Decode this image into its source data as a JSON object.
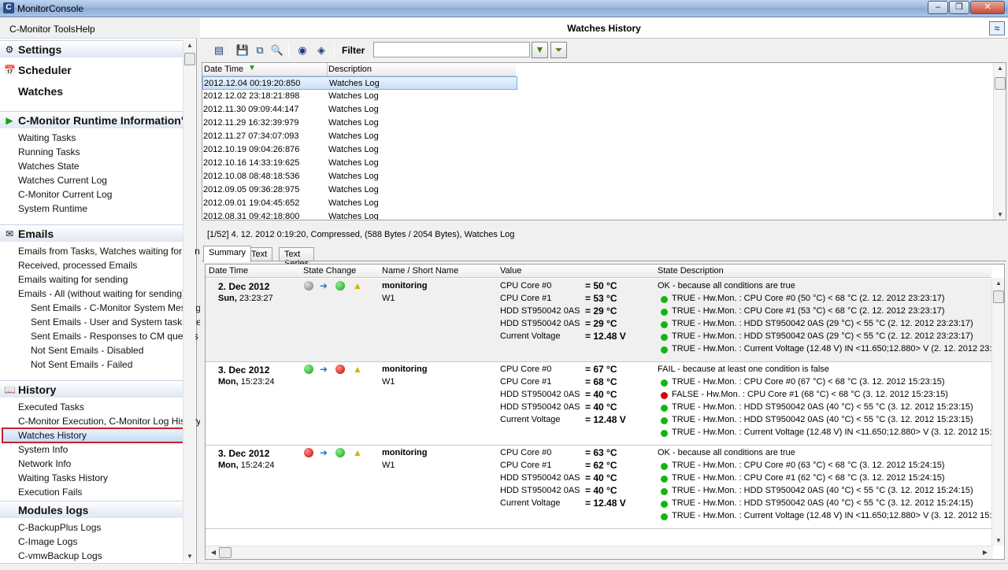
{
  "window": {
    "title": "MonitorConsole",
    "icon": "C"
  },
  "menu": {
    "tools": "C-Monitor Tools",
    "help": "Help"
  },
  "sidebar": {
    "settings": "Settings",
    "scheduler": "Scheduler",
    "watches": "Watches",
    "runtime_header": "C-Monitor Runtime Information'",
    "runtime_items": [
      "Waiting Tasks",
      "Running Tasks",
      "Watches State",
      "Watches Current Log",
      "C-Monitor Current Log",
      "System Runtime"
    ],
    "emails_header": "Emails",
    "emails_items": [
      "Emails from Tasks, Watches waiting for send",
      "Received, processed Emails",
      "Emails waiting for sending",
      "Emails - All (without waiting for sending)"
    ],
    "emails_sub": [
      "Sent Emails - C-Monitor System Message",
      "Sent Emails - User and System tasks Res",
      "Sent Emails - Responses to CM queries",
      "Not Sent Emails - Disabled",
      "Not Sent Emails - Failed"
    ],
    "history_header": "History",
    "history_items": [
      "Executed Tasks",
      "C-Monitor Execution, C-Monitor Log History",
      "Watches History",
      "System Info",
      "Network Info",
      "Waiting Tasks History",
      "Execution Fails"
    ],
    "modules_header": "Modules logs",
    "modules_items": [
      "C-BackupPlus Logs",
      "C-Image Logs",
      "C-vmwBackup Logs"
    ]
  },
  "panel": {
    "title": "Watches History",
    "filter_label": "Filter",
    "filter_value": ""
  },
  "log_grid": {
    "columns": [
      "Date Time",
      "Description"
    ],
    "rows": [
      [
        "2012.12.04  00:19:20:850",
        "Watches Log"
      ],
      [
        "2012.12.02  23:18:21:898",
        "Watches Log"
      ],
      [
        "2012.11.30  09:09:44:147",
        "Watches Log"
      ],
      [
        "2012.11.29  16:32:39:979",
        "Watches Log"
      ],
      [
        "2012.11.27  07:34:07:093",
        "Watches Log"
      ],
      [
        "2012.10.19  09:04:26:876",
        "Watches Log"
      ],
      [
        "2012.10.16  14:33:19:625",
        "Watches Log"
      ],
      [
        "2012.10.08  08:48:18:536",
        "Watches Log"
      ],
      [
        "2012.09.05  09:36:28:975",
        "Watches Log"
      ],
      [
        "2012.09.01  19:04:45:652",
        "Watches Log"
      ],
      [
        "2012.08.31  09:42:18:800",
        "Watches Log"
      ]
    ]
  },
  "info_line": "[1/52]   4. 12. 2012 0:19:20, Compressed, (588 Bytes / 2054 Bytes), Watches Log",
  "tabs": [
    "Summary",
    "Text",
    "Text Series"
  ],
  "summary": {
    "columns": [
      "Date Time",
      "State Change",
      "Name / Short Name",
      "Value",
      "State Description"
    ],
    "records": [
      {
        "date": "2. Dec 2012",
        "weekday": "Sun,",
        "time": "23:23:27",
        "state_from": "gray",
        "state_to": "green",
        "name": "monitoring",
        "short": "W1",
        "values": [
          [
            "CPU Core #0",
            "= 50 °C"
          ],
          [
            "CPU Core #1",
            "= 53 °C"
          ],
          [
            "HDD ST950042 0AS",
            "= 29 °C"
          ],
          [
            "HDD ST950042 0AS",
            "= 29 °C"
          ],
          [
            "Current Voltage",
            "= 12.48 V"
          ]
        ],
        "state_summary": "OK - because all conditions are true",
        "conditions": [
          [
            "green",
            "TRUE - Hw.Mon. : CPU Core #0 (50 °C) < 68 °C (2. 12. 2012 23:23:17)"
          ],
          [
            "green",
            "TRUE - Hw.Mon. : CPU Core #1 (53 °C) < 68 °C (2. 12. 2012 23:23:17)"
          ],
          [
            "green",
            "TRUE - Hw.Mon. : HDD ST950042 0AS (29 °C) < 55 °C (2. 12. 2012 23:23:17)"
          ],
          [
            "green",
            "TRUE - Hw.Mon. : HDD ST950042 0AS (29 °C) < 55 °C (2. 12. 2012 23:23:17)"
          ],
          [
            "green",
            "TRUE - Hw.Mon. : Current Voltage (12.48 V) IN <11.650;12.880> V (2. 12. 2012 23:2"
          ]
        ]
      },
      {
        "date": "3. Dec 2012",
        "weekday": "Mon,",
        "time": "15:23:24",
        "state_from": "green",
        "state_to": "red",
        "name": "monitoring",
        "short": "W1",
        "values": [
          [
            "CPU Core #0",
            "= 67 °C"
          ],
          [
            "CPU Core #1",
            "= 68 °C"
          ],
          [
            "HDD ST950042 0AS",
            "= 40 °C"
          ],
          [
            "HDD ST950042 0AS",
            "= 40 °C"
          ],
          [
            "Current Voltage",
            "= 12.48 V"
          ]
        ],
        "state_summary": "FAIL - because at least one condition is false",
        "conditions": [
          [
            "green",
            "TRUE - Hw.Mon. : CPU Core #0 (67 °C) < 68 °C (3. 12. 2012 15:23:15)"
          ],
          [
            "red",
            "FALSE - Hw.Mon. : CPU Core #1 (68 °C) < 68 °C (3. 12. 2012 15:23:15)"
          ],
          [
            "green",
            "TRUE - Hw.Mon. : HDD ST950042 0AS (40 °C) < 55 °C (3. 12. 2012 15:23:15)"
          ],
          [
            "green",
            "TRUE - Hw.Mon. : HDD ST950042 0AS (40 °C) < 55 °C (3. 12. 2012 15:23:15)"
          ],
          [
            "green",
            "TRUE - Hw.Mon. : Current Voltage (12.48 V) IN <11.650;12.880> V (3. 12. 2012 15:2"
          ]
        ]
      },
      {
        "date": "3. Dec 2012",
        "weekday": "Mon,",
        "time": "15:24:24",
        "state_from": "red",
        "state_to": "green",
        "name": "monitoring",
        "short": "W1",
        "values": [
          [
            "CPU Core #0",
            "= 63 °C"
          ],
          [
            "CPU Core #1",
            "= 62 °C"
          ],
          [
            "HDD ST950042 0AS",
            "= 40 °C"
          ],
          [
            "HDD ST950042 0AS",
            "= 40 °C"
          ],
          [
            "Current Voltage",
            "= 12.48 V"
          ]
        ],
        "state_summary": "OK - because all conditions are true",
        "conditions": [
          [
            "green",
            "TRUE - Hw.Mon. : CPU Core #0 (63 °C) < 68 °C (3. 12. 2012 15:24:15)"
          ],
          [
            "green",
            "TRUE - Hw.Mon. : CPU Core #1 (62 °C) < 68 °C (3. 12. 2012 15:24:15)"
          ],
          [
            "green",
            "TRUE - Hw.Mon. : HDD ST950042 0AS (40 °C) < 55 °C (3. 12. 2012 15:24:15)"
          ],
          [
            "green",
            "TRUE - Hw.Mon. : HDD ST950042 0AS (40 °C) < 55 °C (3. 12. 2012 15:24:15)"
          ],
          [
            "green",
            "TRUE - Hw.Mon. : Current Voltage (12.48 V) IN <11.650;12.880> V (3. 12. 2012 15:2"
          ]
        ]
      }
    ]
  }
}
